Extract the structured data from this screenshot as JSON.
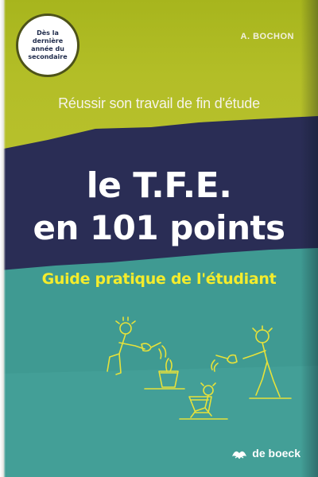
{
  "cover": {
    "badge_text": "Dès la\ndernière\nannée du\nsecondaire",
    "author": "A. BOCHON",
    "subtitle": "Réussir son travail de fin d'étude",
    "title_line1": "le T.F.E.",
    "title_line2": "en 101 points",
    "tagline": "Guide pratique de l'étudiant",
    "publisher": "de boeck"
  },
  "colors": {
    "yellow_green": "#b3be27",
    "navy": "#2a2d55",
    "teal": "#3f9a92",
    "tagline_yellow": "#f4ec2c",
    "illustration_line": "#e7e23a"
  },
  "icons": [
    "publisher-logo-icon"
  ]
}
